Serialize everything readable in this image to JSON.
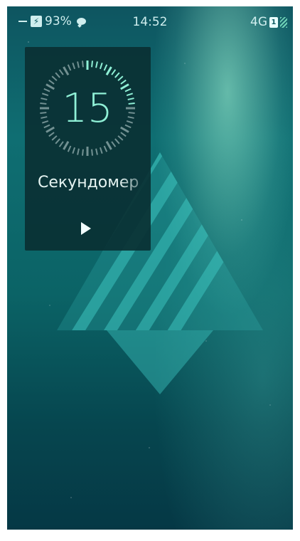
{
  "status_bar": {
    "battery_percent": "93%",
    "time": "14:52",
    "network": "4G",
    "sim_slot": "1"
  },
  "stopwatch_cover": {
    "seconds": "15",
    "title": "Секундомер",
    "elapsed_fraction": 0.25,
    "accent_color": "#8ff0d6"
  },
  "icons": {
    "charging": "charging-bolt-icon",
    "notification": "notification-bubble-icon",
    "sim": "sim-card-icon",
    "signal": "signal-strength-icon",
    "play": "play-icon"
  },
  "wallpaper": {
    "logo": "sailfish-os-logo"
  }
}
